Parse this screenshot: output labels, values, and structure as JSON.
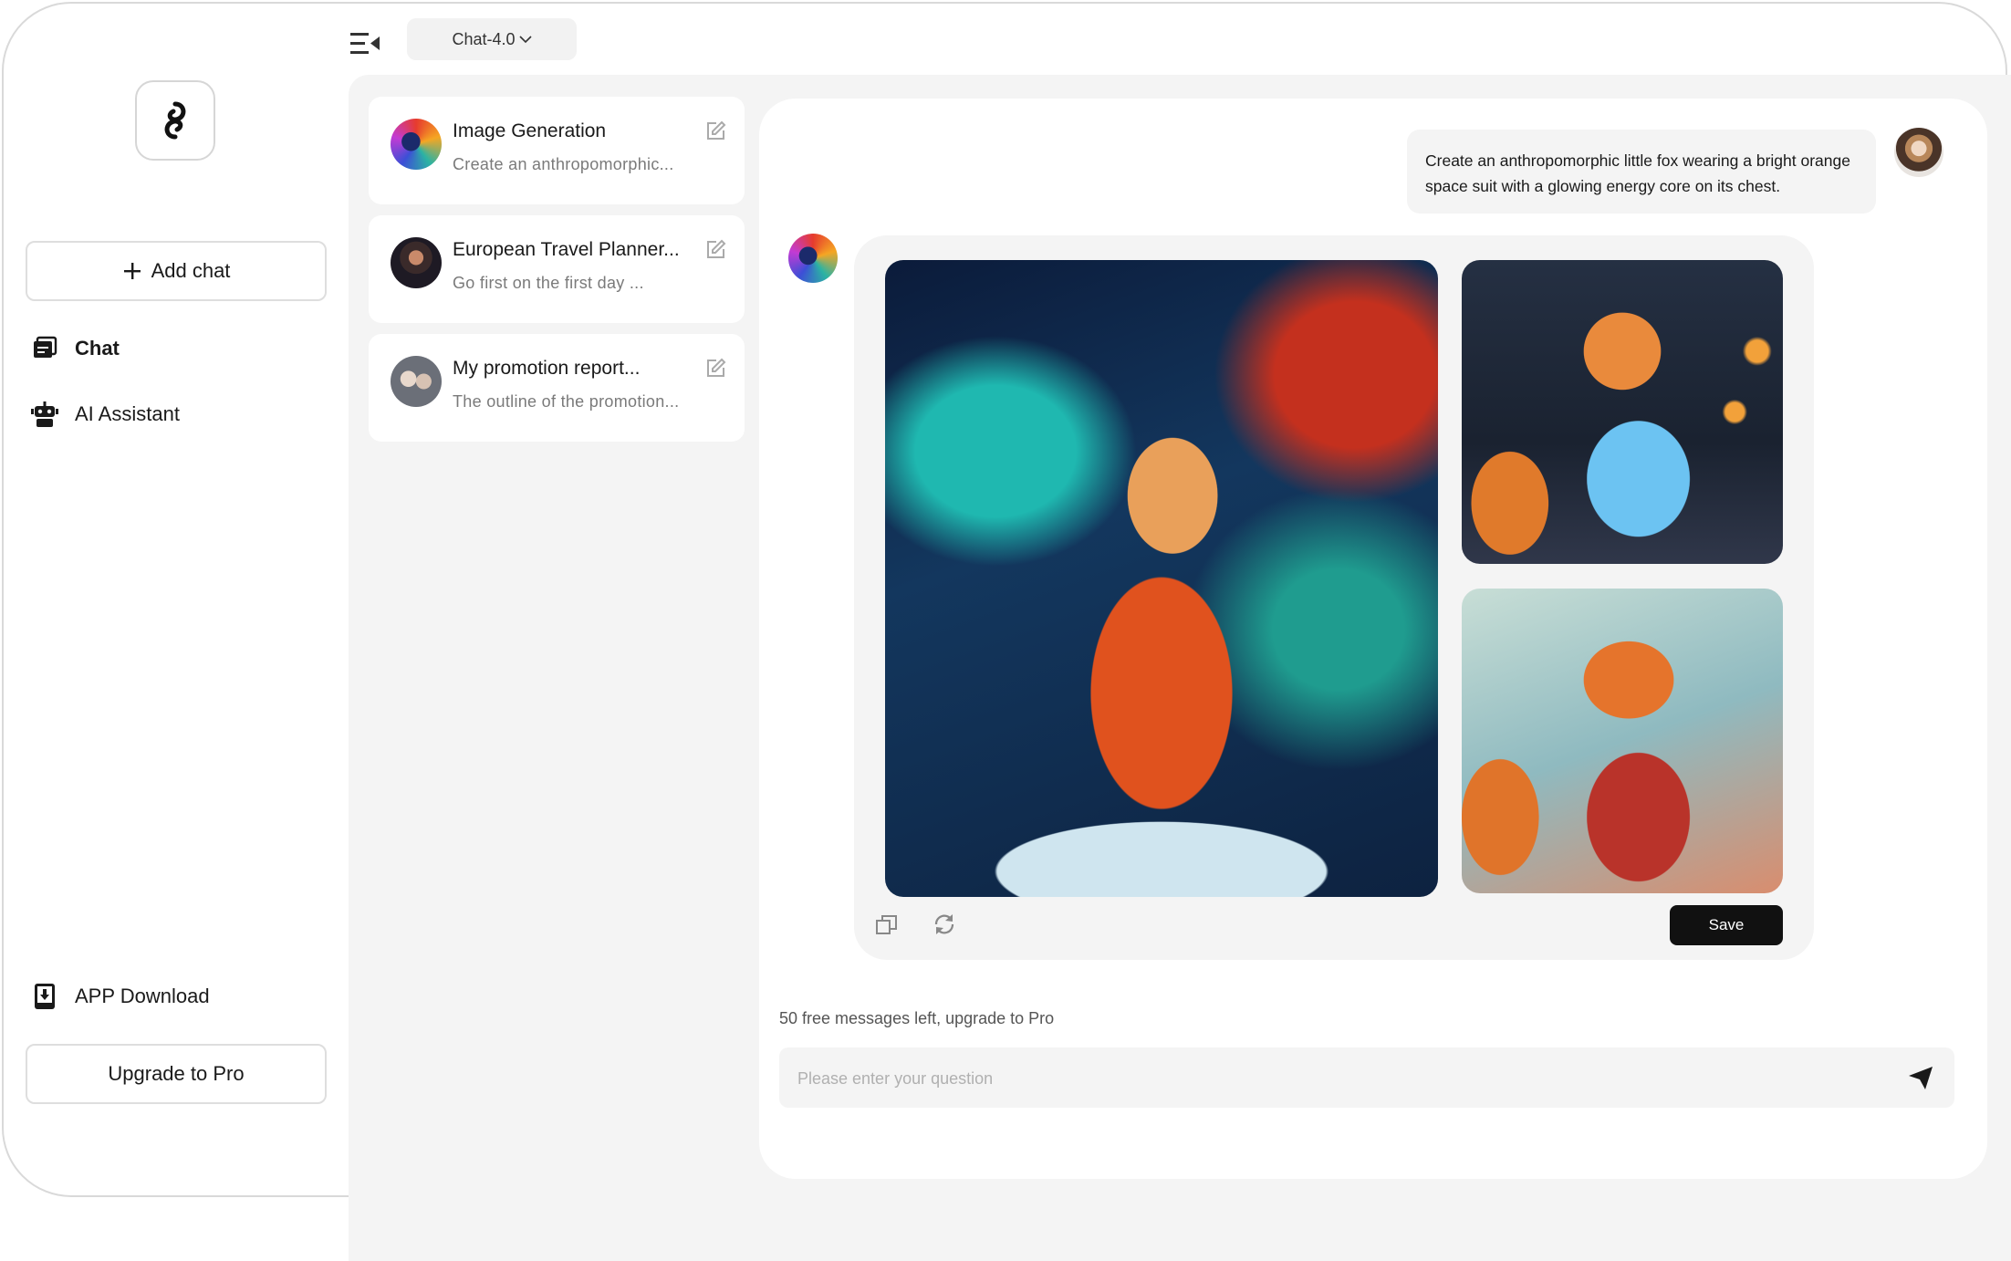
{
  "top_bar": {
    "model": "Chat-4.0",
    "collapse_icon": "sidebar-collapse-icon"
  },
  "sidebar": {
    "add_chat_label": "Add chat",
    "nav": [
      {
        "label": "Chat",
        "icon": "chat-icon",
        "active": true
      },
      {
        "label": "AI Assistant",
        "icon": "robot-icon",
        "active": false
      }
    ],
    "app_download_label": "APP Download",
    "upgrade_label": "Upgrade to Pro"
  },
  "history": [
    {
      "title": "Image Generation",
      "subtitle": "Create an anthropomorphic..."
    },
    {
      "title": "European Travel Planner...",
      "subtitle": "Go first on the first day ..."
    },
    {
      "title": "My promotion report...",
      "subtitle": "The outline of the promotion..."
    }
  ],
  "conversation": {
    "user_message": "Create an anthropomorphic little fox wearing a bright orange space suit with a glowing energy core on its chest.",
    "save_label": "Save"
  },
  "composer": {
    "quota_text": "50 free messages left, upgrade to Pro",
    "placeholder": "Please enter your question"
  },
  "colors": {
    "accent": "#111111",
    "panel_bg": "#f4f4f4"
  }
}
